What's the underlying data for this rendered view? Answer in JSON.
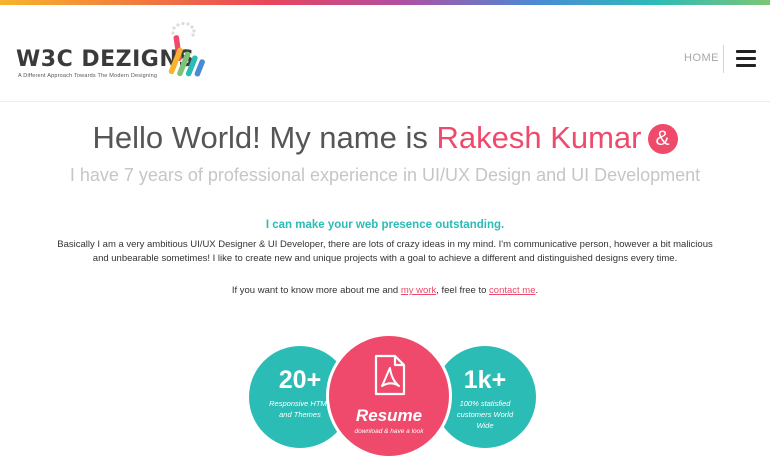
{
  "brand": {
    "name": "W3C DEZIGNS",
    "tagline": "A Different Approach Towards The Modern Designing",
    "colors": {
      "pink": "#ef4a6b",
      "teal": "#2bbcb6"
    }
  },
  "nav": {
    "home_label": "HOME",
    "menu_icon": "hamburger-icon"
  },
  "hero": {
    "title_prefix": "Hello World! My name is ",
    "name": "Rakesh Kumar",
    "amp_symbol": "&",
    "subtitle": "I have 7 years of professional experience in UI/UX Design and UI Development"
  },
  "about": {
    "tagline": "I can make your web presence outstanding.",
    "paragraph": "Basically I am a very ambitious UI/UX Designer & UI Developer, there are lots of crazy ideas in my mind. I'm communicative person, however a bit malicious and unbearable sometimes! I like to create new and unique projects with a goal to achieve a different and distinguished designs every time.",
    "cta_prefix": "If you want to know more about me and ",
    "cta_link1": "my work",
    "cta_middle": ", feel free to ",
    "cta_link2": "contact me",
    "cta_suffix": "."
  },
  "stats": {
    "left": {
      "number": "20+",
      "text": "Responsive HTML and Themes"
    },
    "middle": {
      "icon": "pdf-document-icon",
      "label": "Resume",
      "sub": "download & have a look"
    },
    "right": {
      "number": "1k+",
      "text": "100% statisfied customers World Wide"
    }
  }
}
